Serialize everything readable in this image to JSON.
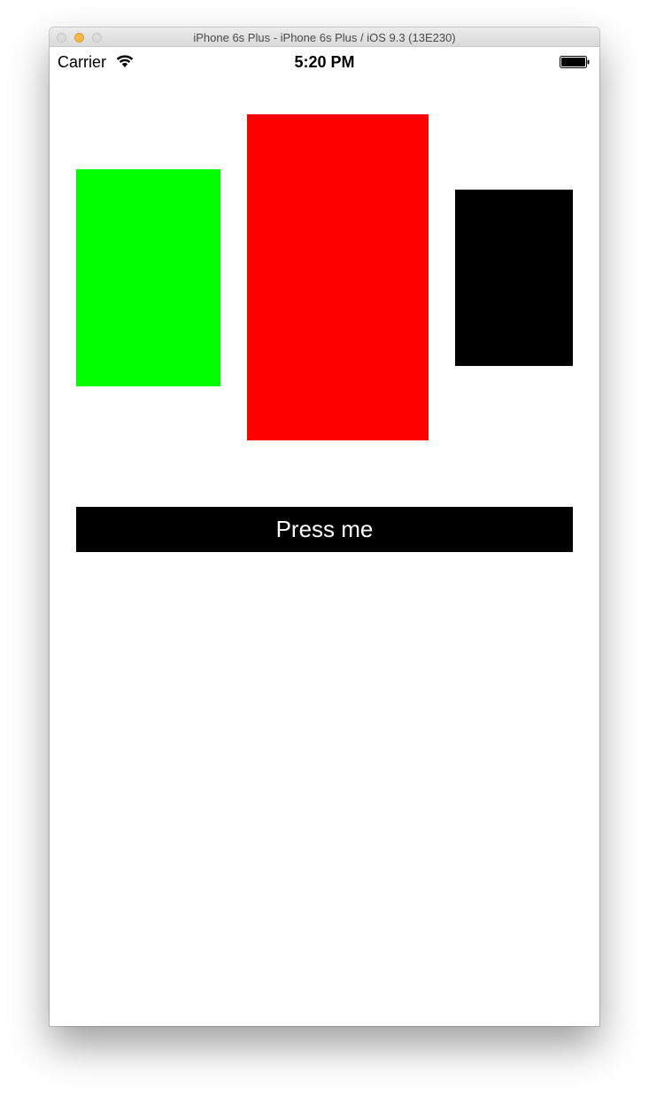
{
  "window": {
    "title": "iPhone 6s Plus - iPhone 6s Plus / iOS 9.3 (13E230)"
  },
  "status_bar": {
    "carrier": "Carrier",
    "time": "5:20 PM",
    "wifi_icon": "wifi-icon",
    "battery_icon": "battery-icon",
    "battery_level": 1.0
  },
  "views": {
    "green_box_color": "#00ff00",
    "red_box_color": "#ff0000",
    "black_box_color": "#000000"
  },
  "button": {
    "label": "Press me",
    "background": "#000000",
    "text_color": "#ffffff"
  },
  "traffic_lights": {
    "minimize_color": "#f6b94a",
    "inactive_color": "#dcdcdc"
  }
}
